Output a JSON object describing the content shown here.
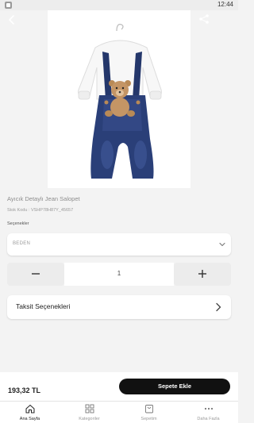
{
  "status_bar": {
    "time": "12:44"
  },
  "product": {
    "title": "Ayıcık Detaylı Jean Salopet",
    "stock_code": "Stok Kodu : VSHP78H87Y_45657",
    "options_label": "Seçenekler",
    "size_placeholder": "BEDEN",
    "quantity": "1",
    "installments_label": "Taksit Seçenekleri",
    "price": "193,32 TL",
    "add_to_cart_label": "Sepete Ekle"
  },
  "tabs": [
    {
      "label": "Ana Sayfa",
      "icon": "home-icon",
      "active": true
    },
    {
      "label": "Kategoriler",
      "icon": "grid-icon",
      "active": false
    },
    {
      "label": "Sepetim",
      "icon": "bag-icon",
      "active": false
    },
    {
      "label": "Daha Fazla",
      "icon": "more-icon",
      "active": false
    }
  ],
  "colors": {
    "accent": "#111111",
    "background": "#f3f3f3",
    "denim": "#24376b"
  }
}
